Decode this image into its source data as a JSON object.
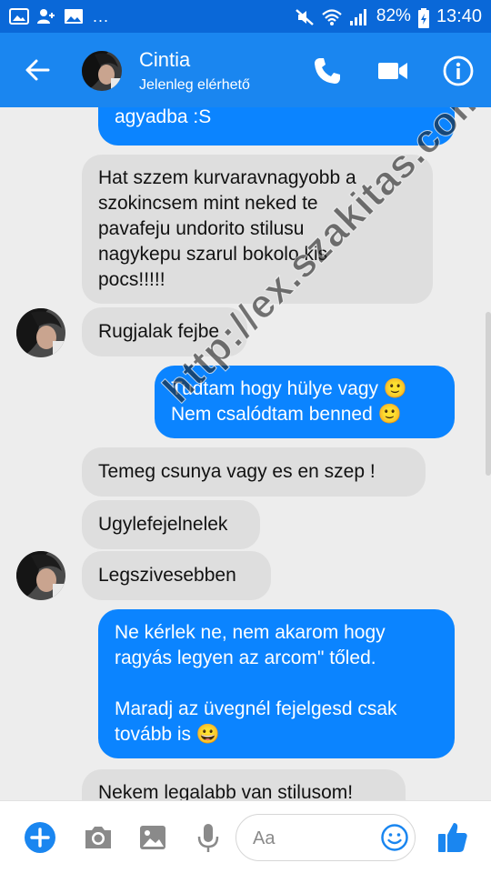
{
  "status_bar": {
    "battery": "82%",
    "time": "13:40",
    "dots": "..."
  },
  "header": {
    "contact_name": "Cintia",
    "contact_status": "Jelenleg elérhető"
  },
  "messages": [
    {
      "side": "out",
      "text": "agyadba :S"
    },
    {
      "side": "in",
      "text": "Hat szzem kurvaravnagyobb a\nszokincsem mint neked te\npavafeju undorito stilusu\nnagykepu szarul bokolo kis\npocs!!!!!"
    },
    {
      "side": "in",
      "text": "Rugjalak fejbe"
    },
    {
      "side": "out",
      "text": "Tudtam hogy hülye vagy 🙂\nNem csalódtam benned 🙂"
    },
    {
      "side": "in",
      "text": "Temeg csunya vagy es en szep !"
    },
    {
      "side": "in",
      "text": "Ugylefejelnelek"
    },
    {
      "side": "in",
      "text": "Legszivesebben"
    },
    {
      "side": "out",
      "text": "Ne kérlek ne, nem akarom hogy\nragyás legyen az arcom\" tőled.\n\nMaradj az üvegnél fejelgesd csak\ntovább is 😀"
    },
    {
      "side": "in",
      "text": "Nekem legalabb van stilusom!"
    }
  ],
  "watermark": "http://ex.szakitas.com",
  "composer": {
    "placeholder": "Aa"
  },
  "colors": {
    "status_bar": "#0a68d8",
    "header": "#1a86f0",
    "outgoing_bubble": "#0b84ff",
    "incoming_bubble": "#dedede",
    "chat_background": "#ededed",
    "accent": "#1a86f0"
  },
  "icons": {
    "status_left": [
      "gallery-icon",
      "add-contact-icon",
      "image-icon"
    ],
    "status_right": [
      "mute-icon",
      "wifi-icon",
      "signal-icon",
      "battery-icon"
    ],
    "header": [
      "back-arrow-icon",
      "phone-icon",
      "video-camera-icon",
      "info-icon"
    ],
    "composer": [
      "plus-icon",
      "camera-icon",
      "image-icon",
      "microphone-icon",
      "emoji-icon",
      "thumbs-up-icon"
    ]
  }
}
